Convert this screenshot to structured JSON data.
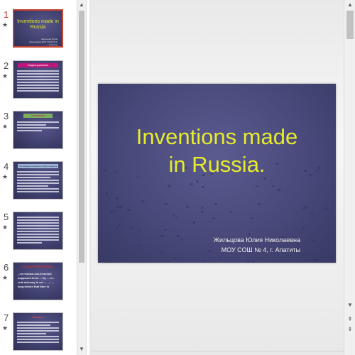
{
  "thumbnail_pane": {
    "slides": [
      {
        "number": "1",
        "active": true,
        "title": "Inventions made in Russia",
        "subtitle": "Жильцова Юлия Николаевна МОУ СОШ № 4, г. Апатиты"
      },
      {
        "number": "2",
        "active": false,
        "header": "Радиоприемник"
      },
      {
        "number": "3",
        "active": false,
        "header": "Телевизор"
      },
      {
        "number": "4",
        "active": false,
        "header": "The Russian inventions & their inventors"
      },
      {
        "number": "5",
        "active": false
      },
      {
        "number": "6",
        "active": false,
        "header": "Do you believe that...",
        "body": "...in russian-not-invented supposed to be ... by ... in... cutt alchemy in sci ... ..... ... long before that time in"
      },
      {
        "number": "7",
        "active": false,
        "header": "Literature"
      }
    ],
    "star_glyph": "★"
  },
  "main_slide": {
    "title_line1": "Inventions made",
    "title_line2": "in Russia.",
    "author_line1": "Жильцова Юлия Николаевна",
    "author_line2": "МОУ СОШ № 4, г. Апатиты",
    "background_color": "#4a4a7c",
    "title_color": "#e7ec2b"
  },
  "scrollbars": {
    "up_glyph": "▲",
    "down_glyph": "▼",
    "prev_slide_glyph": "⇞",
    "next_slide_glyph": "⇟"
  }
}
